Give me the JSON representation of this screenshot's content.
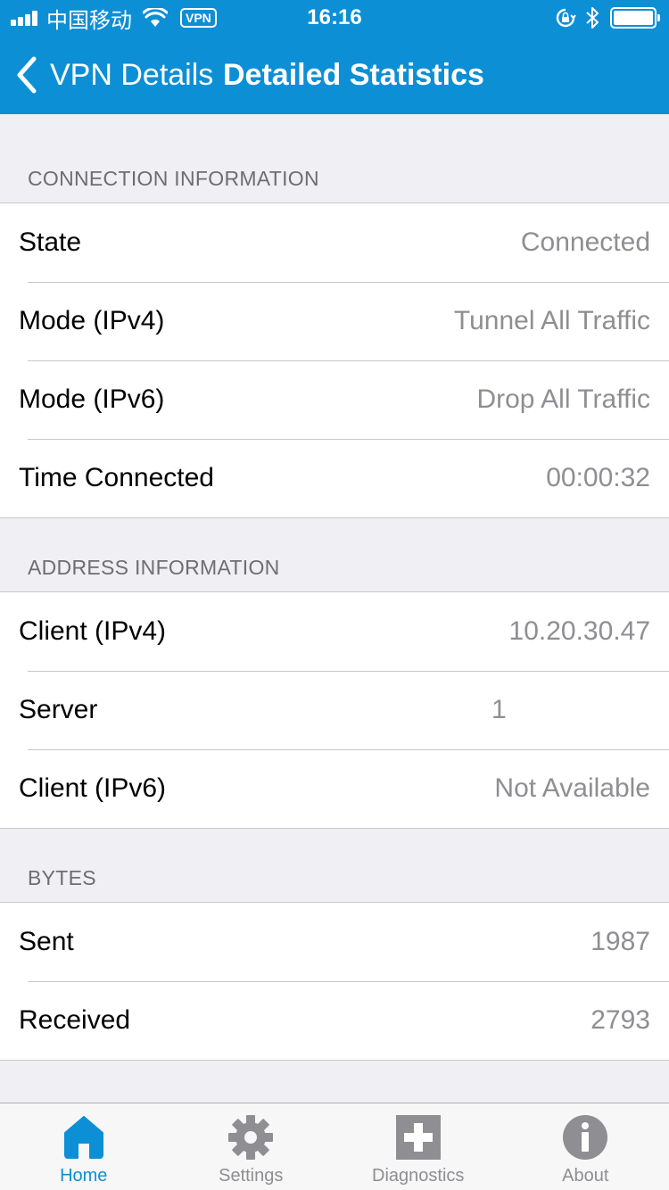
{
  "status_bar": {
    "carrier": "中国移动",
    "vpn": "VPN",
    "time": "16:16"
  },
  "nav": {
    "back_label": "VPN Details",
    "title": "Detailed Statistics"
  },
  "sections": [
    {
      "header": "CONNECTION INFORMATION",
      "rows": [
        {
          "label": "State",
          "value": "Connected"
        },
        {
          "label": "Mode (IPv4)",
          "value": "Tunnel All Traffic"
        },
        {
          "label": "Mode (IPv6)",
          "value": "Drop All Traffic"
        },
        {
          "label": "Time Connected",
          "value": "00:00:32"
        }
      ]
    },
    {
      "header": "ADDRESS INFORMATION",
      "rows": [
        {
          "label": "Client (IPv4)",
          "value": "10.20.30.47"
        },
        {
          "label": "Server",
          "value": "1"
        },
        {
          "label": "Client (IPv6)",
          "value": "Not Available"
        }
      ]
    },
    {
      "header": "BYTES",
      "rows": [
        {
          "label": "Sent",
          "value": "1987"
        },
        {
          "label": "Received",
          "value": "2793"
        }
      ]
    }
  ],
  "tabs": [
    {
      "label": "Home",
      "icon": "home-icon",
      "active": true
    },
    {
      "label": "Settings",
      "icon": "gear-icon",
      "active": false
    },
    {
      "label": "Diagnostics",
      "icon": "plus-box-icon",
      "active": false
    },
    {
      "label": "About",
      "icon": "info-icon",
      "active": false
    }
  ],
  "colors": {
    "accent": "#0d8fd6",
    "background": "#efeff4",
    "value_text": "#8e8e93",
    "inactive_tab": "#8e8e93"
  }
}
